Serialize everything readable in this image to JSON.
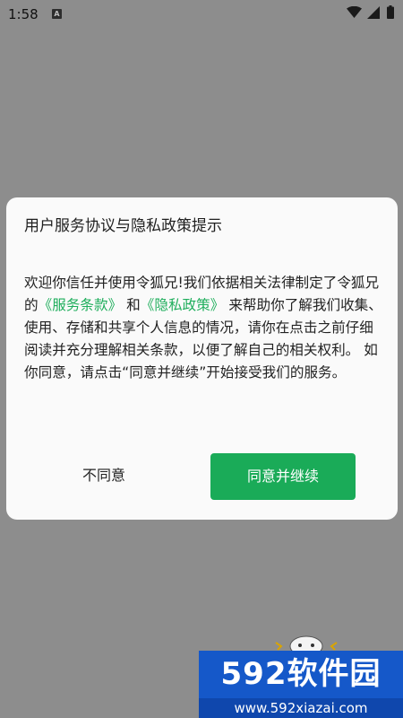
{
  "statusbar": {
    "time": "1:58",
    "notification_icon": "A"
  },
  "dialog": {
    "title": "用户服务协议与隐私政策提示",
    "body_part1": "欢迎你信任并使用令狐兄!我们依据相关法律制定了令狐兄的",
    "link_terms": "《服务条款》",
    "body_and": "和",
    "link_privacy": "《隐私政策》",
    "body_part2": "来帮助你了解我们收集、使用、存储和共享个人信息的情况，请你在点击之前仔细阅读并充分理解相关条款，以便了解自己的相关权利。 如你同意，请点击“同意并继续”开始接受我们的服务。",
    "decline_label": "不同意",
    "accept_label": "同意并继续"
  },
  "watermark": {
    "brand": "592软件园",
    "site": "www.592xiazai.com"
  },
  "colors": {
    "accent": "#1aab58",
    "link": "#1fae5c",
    "overlay": "#8d8d8d",
    "watermark_blue": "#1558c9"
  }
}
